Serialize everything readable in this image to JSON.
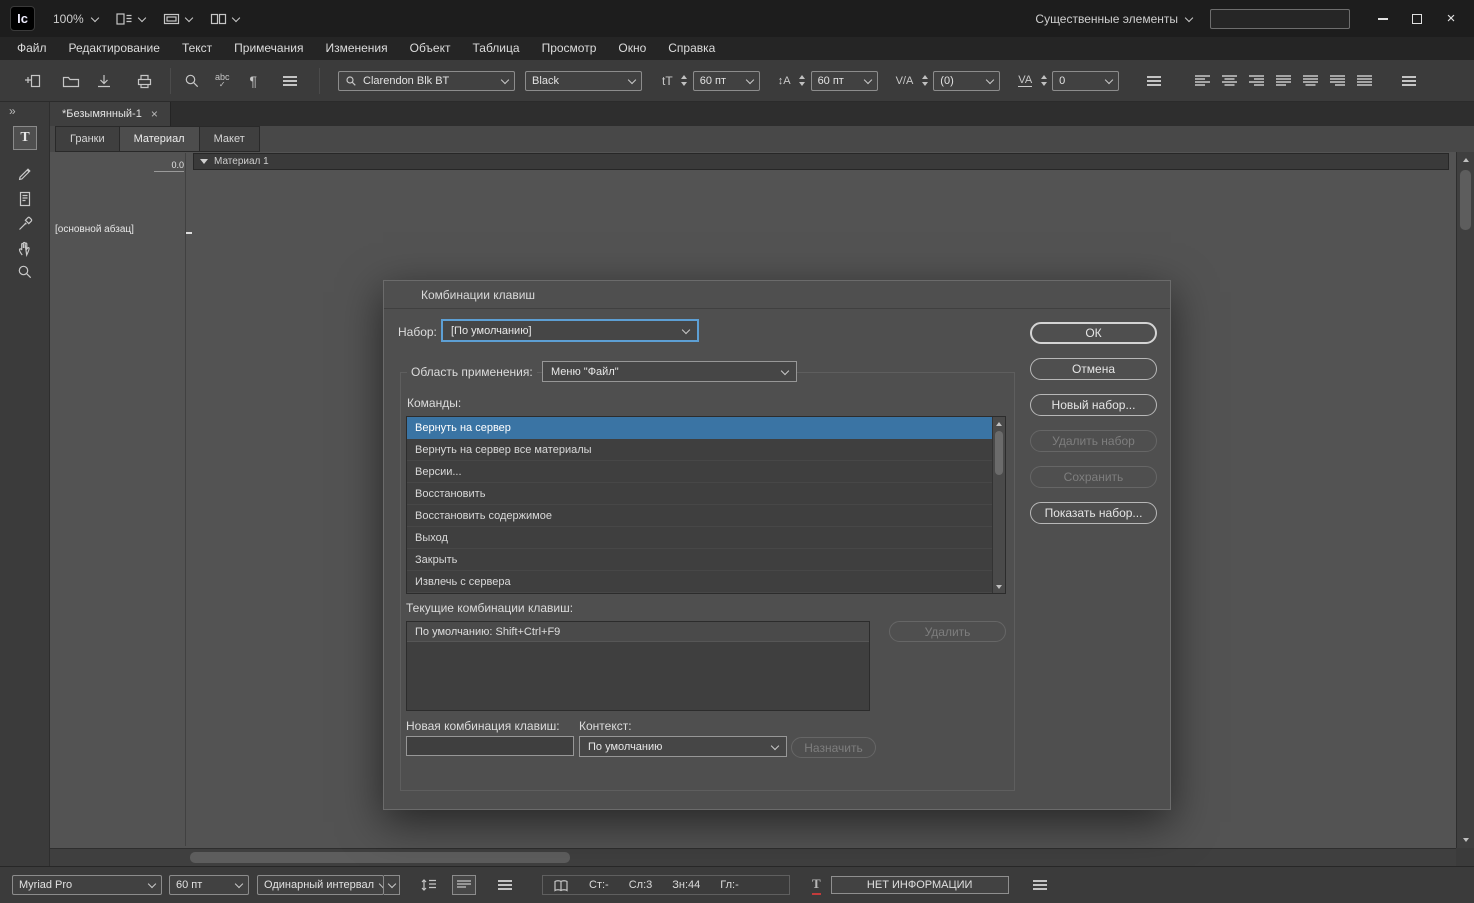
{
  "titlebar": {
    "logo": "Ic",
    "zoom_value": "100%",
    "workspace_switcher": "Существенные элементы",
    "search_value": ""
  },
  "menubar": {
    "items": [
      "Файл",
      "Редактирование",
      "Текст",
      "Примечания",
      "Изменения",
      "Объект",
      "Таблица",
      "Просмотр",
      "Окно",
      "Справка"
    ]
  },
  "toolbar": {
    "font_family": "Clarendon Blk BT",
    "font_style": "Black",
    "font_size": "60 пт",
    "leading": "60 пт",
    "kerning": "(0)",
    "tracking": "0"
  },
  "document": {
    "tab_title": "*Безымянный-1",
    "view_tabs": [
      "Гранки",
      "Материал",
      "Макет"
    ],
    "active_view_tab": "Материал",
    "story_bar": "Материал 1",
    "ruler_origin": "0.0",
    "paragraph_style": "[основной абзац]"
  },
  "dialog": {
    "title": "Комбинации клавиш",
    "set_label": "Набор:",
    "set_value": "[По умолчанию]",
    "buttons": {
      "ok": "ОК",
      "cancel": "Отмена",
      "new_set": "Новый набор...",
      "delete_set": "Удалить набор",
      "save": "Сохранить",
      "show_set": "Показать набор..."
    },
    "area_label": "Область применения:",
    "area_value": "Меню \"Файл\"",
    "commands_label": "Команды:",
    "commands": [
      "Вернуть на сервер",
      "Вернуть на сервер все материалы",
      "Версии...",
      "Восстановить",
      "Восстановить содержимое",
      "Выход",
      "Закрыть",
      "Извлечь с сервера"
    ],
    "selected_command": "Вернуть на сервер",
    "current_label": "Текущие комбинации клавиш:",
    "current_shortcut": "По умолчанию: Shift+Ctrl+F9",
    "remove_button": "Удалить",
    "new_shortcut_label": "Новая комбинация клавиш:",
    "new_shortcut_value": "",
    "context_label": "Контекст:",
    "context_value": "По умолчанию",
    "assign_button": "Назначить"
  },
  "statusbar": {
    "font": "Myriad Pro",
    "size": "60 пт",
    "spacing": "Одинарный интервал",
    "counters": [
      "Ст:-",
      "Сл:3",
      "Зн:44",
      "Гл:-"
    ],
    "info": "НЕТ ИНФОРМАЦИИ"
  },
  "icons": {
    "close": "×",
    "pilcrow": "¶",
    "spellcheck": "abc",
    "collapse": "»",
    "type_tool_glyph": "T",
    "font_size_glyph": "tT",
    "leading_glyph": "↕A",
    "kerning_glyph": "V/A",
    "tracking_glyph": "VA",
    "overset_glyph": "T"
  }
}
